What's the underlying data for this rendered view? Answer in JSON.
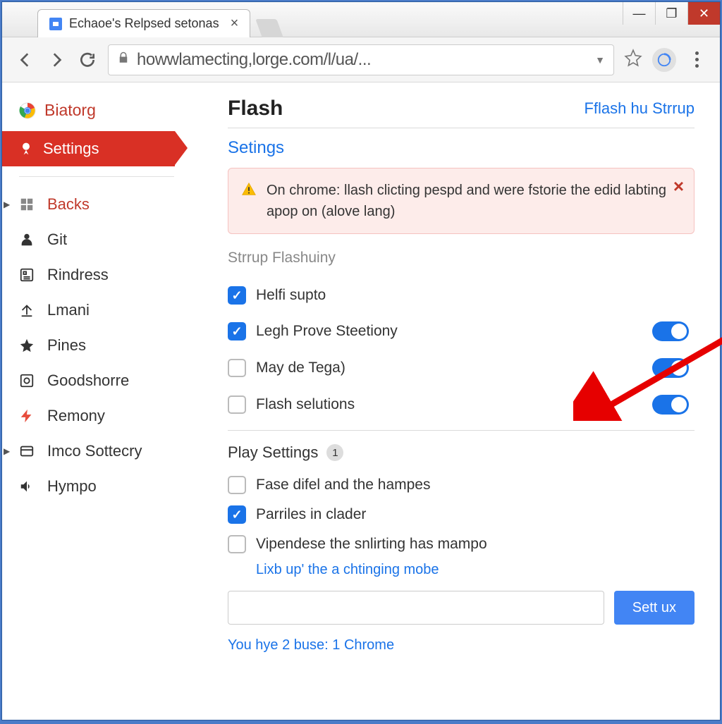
{
  "window": {
    "tab_title": "Echaoe's Relpsed setonas",
    "url": "howwlamecting,lorge.com/l/ua/..."
  },
  "sidebar": {
    "header": "Biatorg",
    "active": "Settings",
    "items": [
      {
        "label": "Backs",
        "red": true,
        "expand": true
      },
      {
        "label": "Git"
      },
      {
        "label": "Rindress"
      },
      {
        "label": "Lmani"
      },
      {
        "label": "Pines"
      },
      {
        "label": "Goodshorre"
      },
      {
        "label": "Remony"
      },
      {
        "label": "Imco Sottecry",
        "expand": true
      },
      {
        "label": "Hympo"
      }
    ]
  },
  "main": {
    "title": "Flash",
    "title_action": "Fflash hu Strrup",
    "subtitle": "Setings",
    "alert": "On chrome: llash clicting pespd and were fstorie the edid labting apop on (alove lang)",
    "section1_label": "Strrup Flashuiny",
    "options1": [
      {
        "label": "Helfi supto",
        "checked": true,
        "toggle": false
      },
      {
        "label": "Legh Prove Steetiony",
        "checked": true,
        "toggle": true
      },
      {
        "label": "May de Tega)",
        "checked": false,
        "toggle": true
      },
      {
        "label": "Flash selutions",
        "checked": false,
        "toggle": true
      }
    ],
    "section2_title": "Play Settings",
    "section2_badge": "1",
    "options2": [
      {
        "label": "Fase difel and the hampes",
        "checked": false
      },
      {
        "label": "Parriles in clader",
        "checked": true
      },
      {
        "label": "Vipendese the snlirting has mampo",
        "checked": false
      }
    ],
    "link": "Lixb up' the a chtinging mobe",
    "button": "Sett ux",
    "footer": "You hye 2 buse: 1 Chrome"
  }
}
